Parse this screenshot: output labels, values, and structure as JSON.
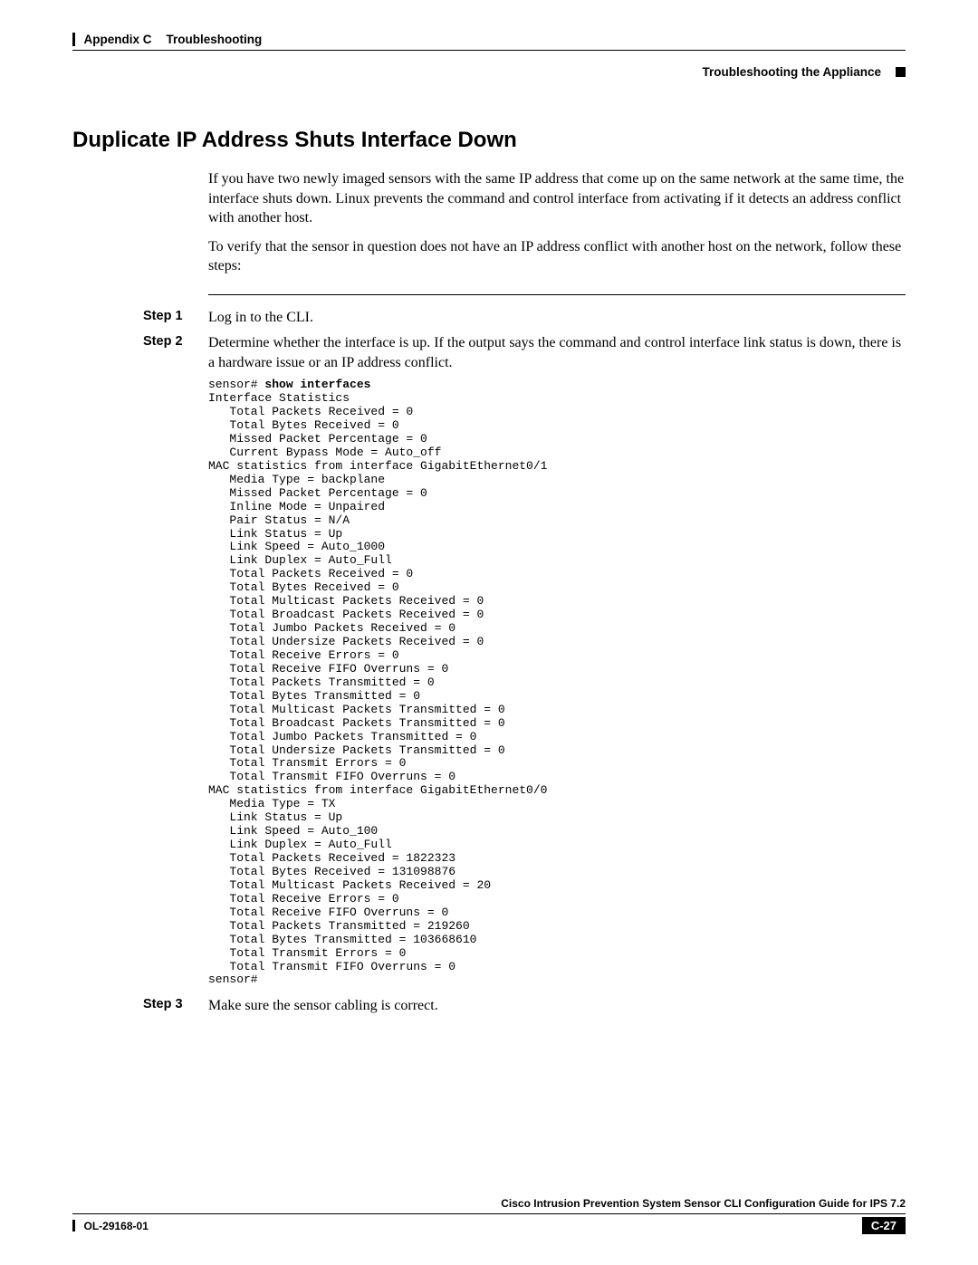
{
  "header": {
    "appendix": "Appendix C",
    "chapter": "Troubleshooting",
    "section": "Troubleshooting the Appliance"
  },
  "title": "Duplicate IP Address Shuts Interface Down",
  "intro": {
    "p1": "If you have two newly imaged sensors with the same IP address that come up on the same network at the same time, the interface shuts down. Linux prevents the command and control interface from activating if it detects an address conflict with another host.",
    "p2": "To verify that the sensor in question does not have an IP address conflict with another host on the network, follow these steps:"
  },
  "steps": {
    "s1": {
      "label": "Step 1",
      "text": "Log in to the CLI."
    },
    "s2": {
      "label": "Step 2",
      "text": "Determine whether the interface is up. If the output says the command and control interface link status is down, there is a hardware issue or an IP address conflict."
    },
    "s3": {
      "label": "Step 3",
      "text": "Make sure the sensor cabling is correct."
    }
  },
  "code": {
    "prompt1": "sensor# ",
    "cmd": "show interfaces",
    "body": "Interface Statistics\n   Total Packets Received = 0\n   Total Bytes Received = 0\n   Missed Packet Percentage = 0\n   Current Bypass Mode = Auto_off\nMAC statistics from interface GigabitEthernet0/1\n   Media Type = backplane\n   Missed Packet Percentage = 0\n   Inline Mode = Unpaired\n   Pair Status = N/A\n   Link Status = Up\n   Link Speed = Auto_1000\n   Link Duplex = Auto_Full\n   Total Packets Received = 0\n   Total Bytes Received = 0\n   Total Multicast Packets Received = 0\n   Total Broadcast Packets Received = 0\n   Total Jumbo Packets Received = 0\n   Total Undersize Packets Received = 0\n   Total Receive Errors = 0\n   Total Receive FIFO Overruns = 0\n   Total Packets Transmitted = 0\n   Total Bytes Transmitted = 0\n   Total Multicast Packets Transmitted = 0\n   Total Broadcast Packets Transmitted = 0\n   Total Jumbo Packets Transmitted = 0\n   Total Undersize Packets Transmitted = 0\n   Total Transmit Errors = 0\n   Total Transmit FIFO Overruns = 0\nMAC statistics from interface GigabitEthernet0/0\n   Media Type = TX\n   Link Status = Up\n   Link Speed = Auto_100\n   Link Duplex = Auto_Full\n   Total Packets Received = 1822323\n   Total Bytes Received = 131098876\n   Total Multicast Packets Received = 20\n   Total Receive Errors = 0\n   Total Receive FIFO Overruns = 0\n   Total Packets Transmitted = 219260\n   Total Bytes Transmitted = 103668610\n   Total Transmit Errors = 0\n   Total Transmit FIFO Overruns = 0\nsensor#"
  },
  "footer": {
    "guide": "Cisco Intrusion Prevention System Sensor CLI Configuration Guide for IPS 7.2",
    "docnum": "OL-29168-01",
    "page": "C-27"
  }
}
